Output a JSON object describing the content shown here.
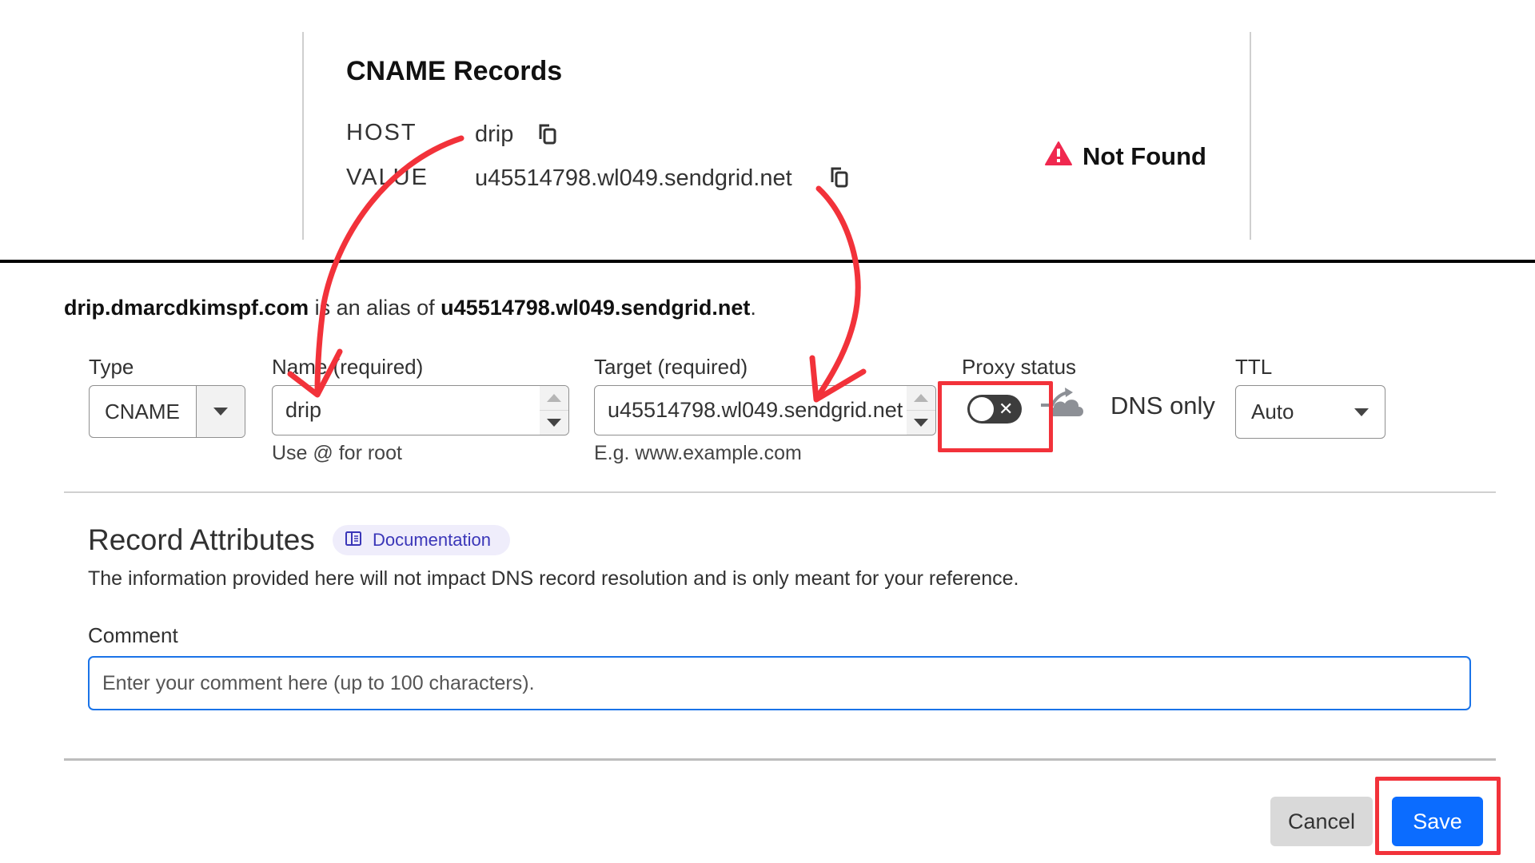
{
  "record_card": {
    "title": "CNAME Records",
    "host_label": "HOST",
    "host_value": "drip",
    "value_label": "VALUE",
    "value_value": "u45514798.wl049.sendgrid.net",
    "status_icon": "warning-triangle-icon",
    "status_text": "Not Found",
    "status_color": "#f0284f"
  },
  "alias_sentence": {
    "name": "drip.dmarcdkimspf.com",
    "middle": " is an alias of ",
    "target": "u45514798.wl049.sendgrid.net",
    "end": "."
  },
  "form": {
    "type_label": "Type",
    "type_value": "CNAME",
    "name_label": "Name (required)",
    "name_value": "drip",
    "name_hint": "Use @ for root",
    "target_label": "Target (required)",
    "target_value": "u45514798.wl049.sendgrid.net",
    "target_hint": "E.g. www.example.com",
    "proxy_label": "Proxy status",
    "proxy_enabled": false,
    "proxy_toggle_glyph": "✕",
    "proxy_state_text": "DNS only",
    "ttl_label": "TTL",
    "ttl_value": "Auto"
  },
  "attributes": {
    "title": "Record Attributes",
    "doc_link": "Documentation",
    "description": "The information provided here will not impact DNS record resolution and is only meant for your reference.",
    "comment_label": "Comment",
    "comment_value": "",
    "comment_placeholder": "Enter your comment here (up to 100 characters)."
  },
  "actions": {
    "cancel": "Cancel",
    "save": "Save"
  },
  "colors": {
    "annotation_red": "#f2323a",
    "primary_blue": "#0b6cff",
    "doc_badge_bg": "#efedfb",
    "doc_badge_text": "#3a36b8"
  }
}
